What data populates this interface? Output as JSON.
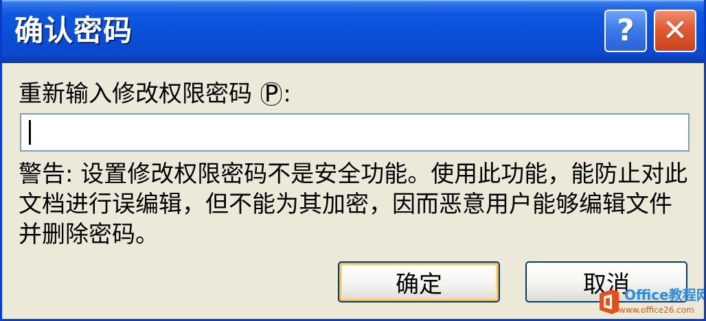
{
  "dialog": {
    "title": "确认密码",
    "help_glyph": "?",
    "close_glyph": "✕"
  },
  "prompt": {
    "label_prefix": "重新输入修改权限密码 ",
    "accelerator": "P",
    "label_suffix": ":"
  },
  "password_field": {
    "value": ""
  },
  "warning_text": "警告: 设置修改权限密码不是安全功能。使用此功能，能防止对此文档进行误编辑，但不能为其加密，因而恶意用户能够编辑文件并删除密码。",
  "buttons": {
    "ok_label": "确定",
    "cancel_label": "取消"
  },
  "watermark": {
    "title": "Office教程网",
    "url": "www.office26.com"
  },
  "colors": {
    "titlebar": "#0A4DD6",
    "dialog_bg": "#ECE9D8",
    "close_button": "#E05A33",
    "help_button": "#3D7BEA"
  },
  "icons": {
    "help": "help-icon",
    "close": "close-icon",
    "watermark_logo": "office-logo-icon"
  }
}
